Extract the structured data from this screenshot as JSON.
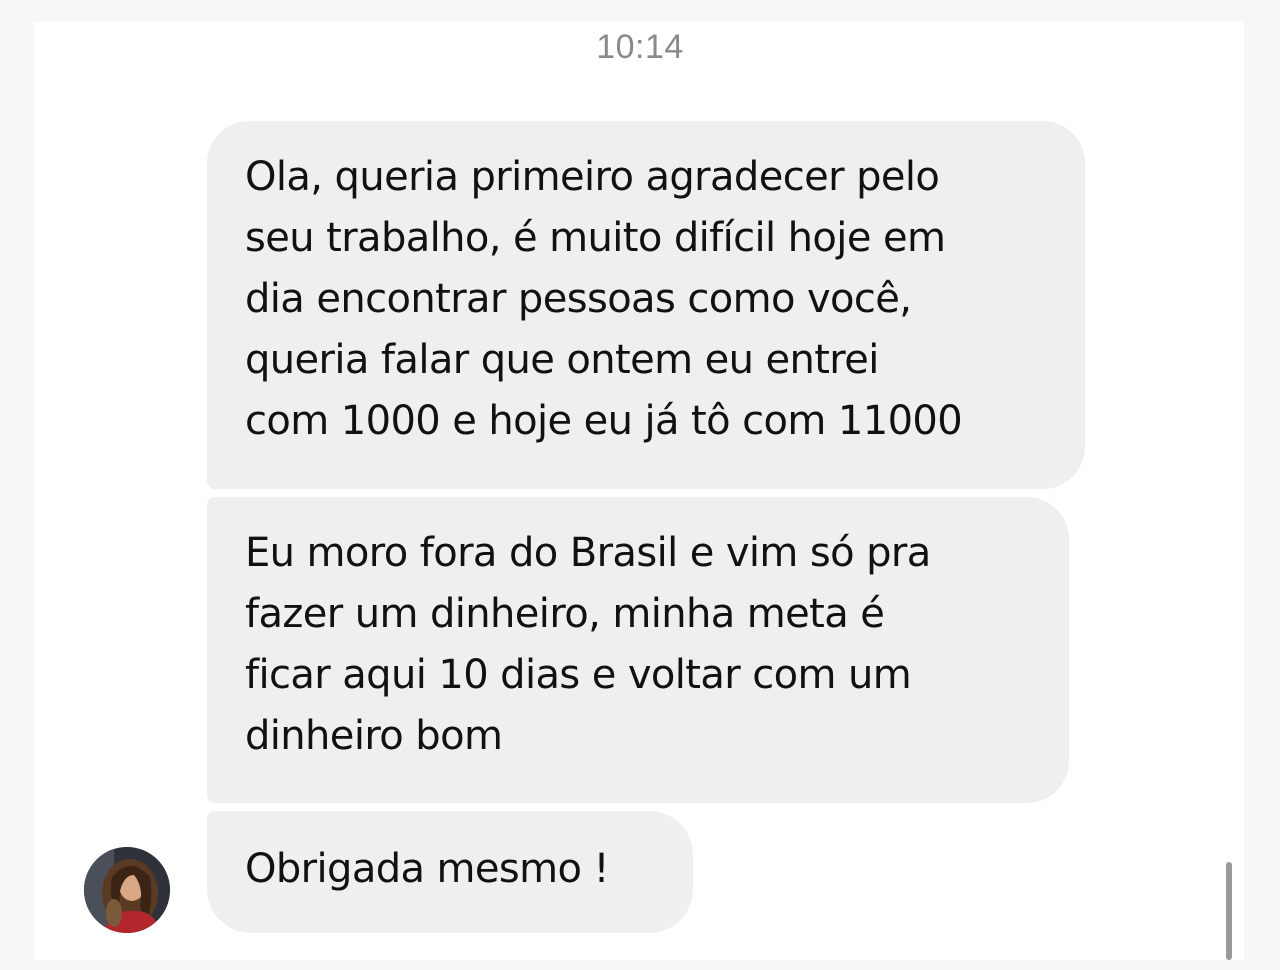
{
  "conversation": {
    "timestamp": "10:14",
    "messages": [
      {
        "text": "Ola, queria primeiro agradecer pelo\nseu trabalho, é muito difícil hoje em\ndia encontrar pessoas como você,\nqueria falar que ontem eu entrei\ncom 1000 e hoje eu já tô com 11000"
      },
      {
        "text": "Eu moro fora do Brasil e vim só pra\nfazer um dinheiro, minha meta é\nficar aqui 10 dias e voltar com um\ndinheiro bom"
      },
      {
        "text": "Obrigada mesmo !"
      }
    ]
  },
  "sender": {
    "avatar_icon": "user-avatar-photo"
  },
  "colors": {
    "bubble_background": "#efefef",
    "timestamp_text": "#8a8a8a",
    "message_text": "#111111"
  }
}
